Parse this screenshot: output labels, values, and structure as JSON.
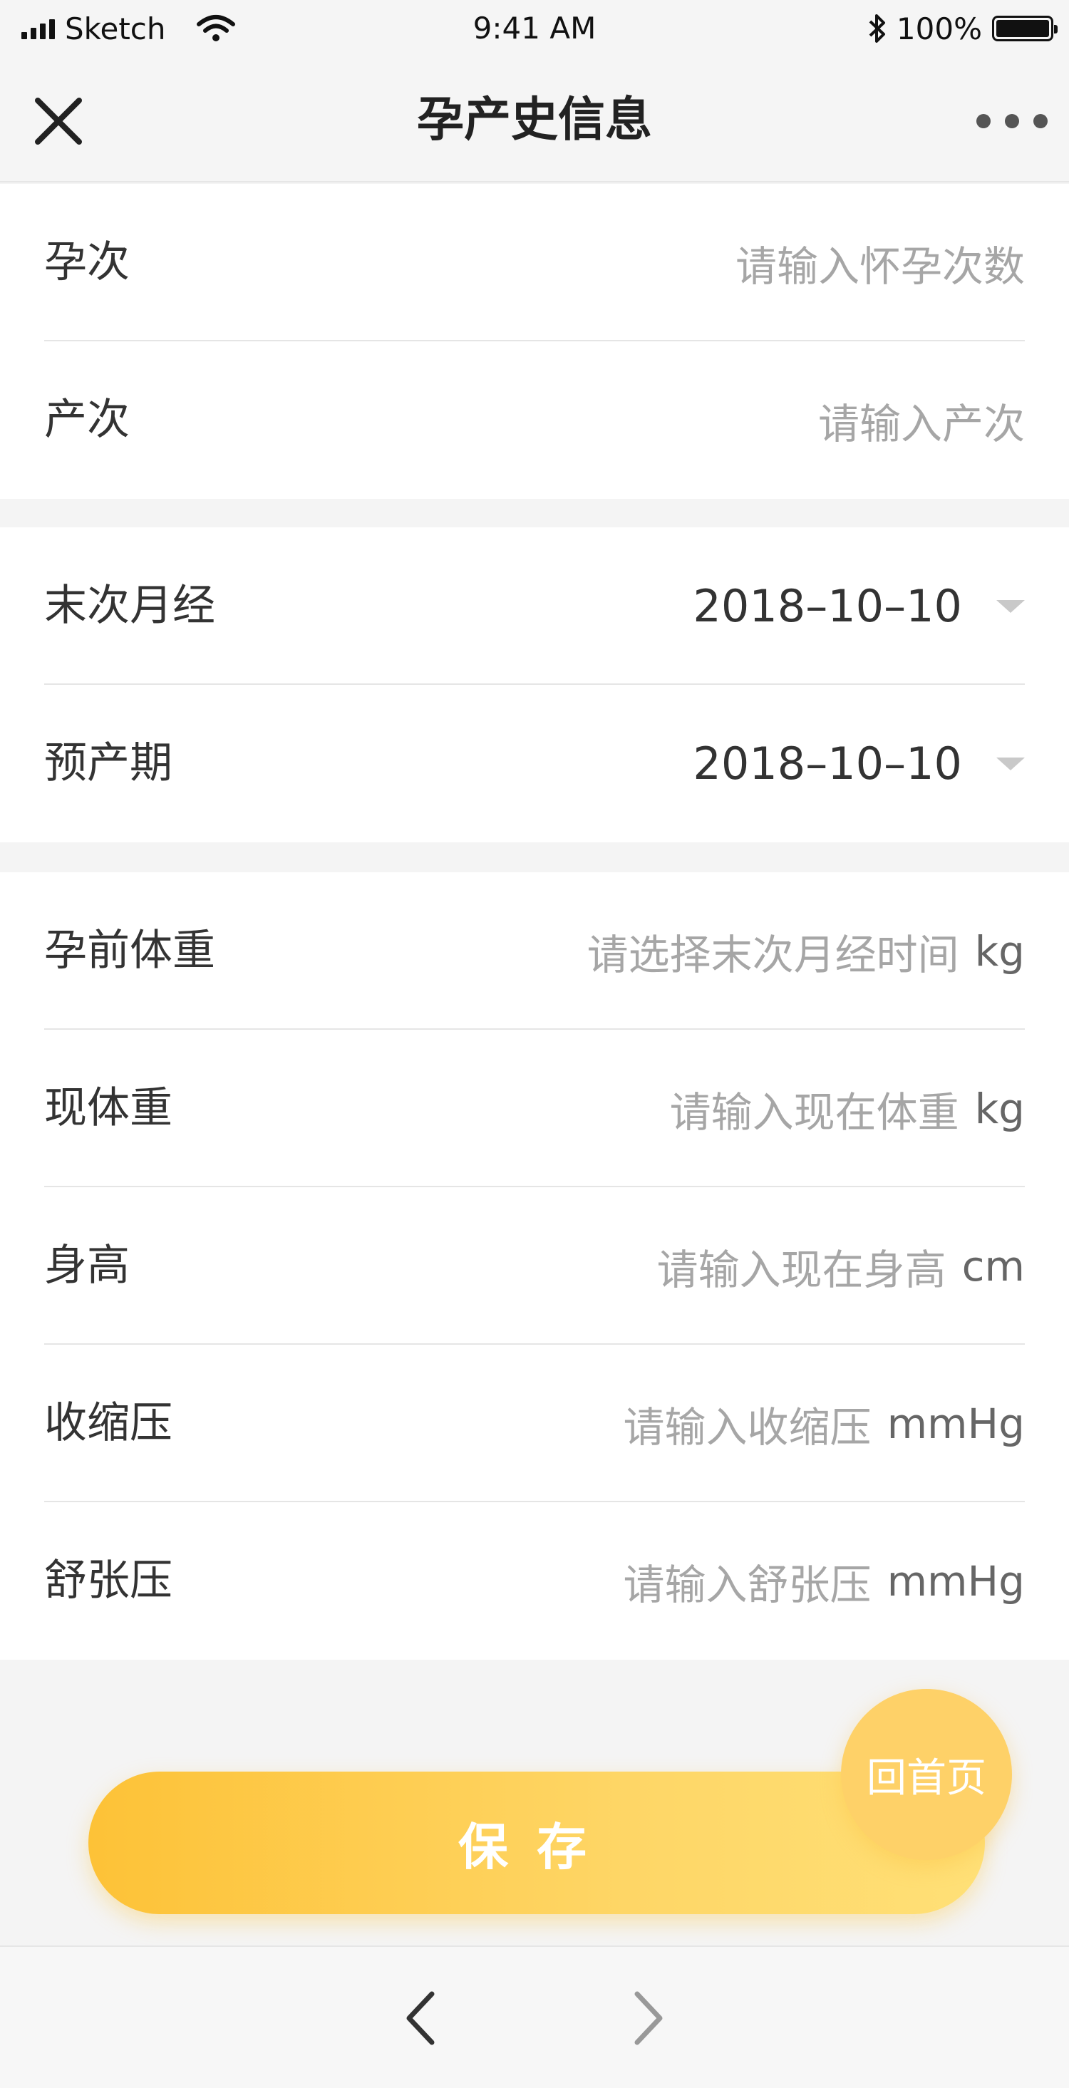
{
  "status_bar": {
    "carrier": "Sketch",
    "time": "9:41 AM",
    "battery": "100%"
  },
  "nav": {
    "title": "孕产史信息"
  },
  "groups": [
    {
      "rows": [
        {
          "label": "孕次",
          "placeholder": "请输入怀孕次数"
        },
        {
          "label": "产次",
          "placeholder": "请输入产次"
        }
      ]
    },
    {
      "rows": [
        {
          "label": "末次月经",
          "value": "2018–10–10"
        },
        {
          "label": "预产期",
          "value": "2018–10–10"
        }
      ]
    },
    {
      "rows": [
        {
          "label": "孕前体重",
          "placeholder": "请选择末次月经时间",
          "unit": "kg"
        },
        {
          "label": "现体重",
          "placeholder": "请输入现在体重",
          "unit": "kg"
        },
        {
          "label": "身高",
          "placeholder": "请输入现在身高",
          "unit": "cm"
        },
        {
          "label": "收缩压",
          "placeholder": "请输入收缩压",
          "unit": "mmHg"
        },
        {
          "label": "舒张压",
          "placeholder": "请输入舒张压",
          "unit": "mmHg"
        }
      ]
    }
  ],
  "save_button": {
    "label": "保存"
  },
  "home_button": {
    "label": "回首页"
  },
  "colors": {
    "accent_start": "#fdc237",
    "accent_end": "#ffe077",
    "placeholder": "#a6a6a6"
  },
  "icons": {
    "close": "close-icon",
    "more": "more-icon",
    "back": "chevron-left-icon",
    "forward": "chevron-right-icon",
    "dropdown": "caret-down-icon"
  }
}
